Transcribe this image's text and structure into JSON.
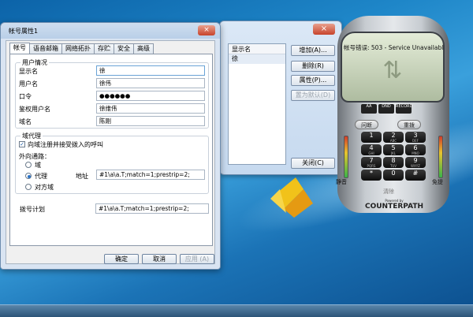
{
  "dialog": {
    "title": "帐号属性1",
    "close_label": "×",
    "tabs": [
      {
        "label": "帐号",
        "active": true
      },
      {
        "label": "语音邮箱",
        "active": false
      },
      {
        "label": "网络拓扑",
        "active": false
      },
      {
        "label": "存贮",
        "active": false
      },
      {
        "label": "安全",
        "active": false
      },
      {
        "label": "高级",
        "active": false
      }
    ],
    "user_info": {
      "group_label": "用户情况",
      "display_name": {
        "label": "显示名",
        "value": "徐"
      },
      "user_name": {
        "label": "用户名",
        "value": "徐伟"
      },
      "password": {
        "label": "口令",
        "value": "●●●●●●"
      },
      "auth_user": {
        "label": "鉴权用户名",
        "value": "徐维伟"
      },
      "domain": {
        "label": "域名",
        "value": "陈刚"
      }
    },
    "proxy": {
      "group_label": "域代理",
      "register_check_label": "向域注册并接受拨入的呼叫",
      "register_checked": true,
      "outbound_label": "外向通路：",
      "options": [
        {
          "label": "域",
          "selected": false
        },
        {
          "label": "代理",
          "selected": true
        },
        {
          "label": "对方域",
          "selected": false
        }
      ],
      "address_label": "地址",
      "address_value": "#1\\a\\a.T;match=1;prestrip=2;"
    },
    "dial_plan": {
      "label": "拨号计划",
      "value": "#1\\a\\a.T;match=1;prestrip=2;"
    },
    "buttons": {
      "ok": "确定",
      "cancel": "取消",
      "apply": "应用 (A)"
    }
  },
  "accounts_window": {
    "close_label": "×",
    "list_header": "显示名",
    "rows": [
      "徐"
    ],
    "buttons": {
      "add": "增加(A)...",
      "remove": "删除(R)",
      "properties": "属性(P)...",
      "set_default": "置为默认(D)",
      "close": "关闭(C)"
    }
  },
  "softphone": {
    "status_text": "帐号错误: 503 - Service Unavailable",
    "mini_buttons": [
      "AA",
      "DND",
      "RECORD"
    ],
    "redial": "问断",
    "hold": "重拨",
    "keys": [
      {
        "digit": "1",
        "sub": ""
      },
      {
        "digit": "2",
        "sub": "ABC"
      },
      {
        "digit": "3",
        "sub": "DEF"
      },
      {
        "digit": "4",
        "sub": "GHI"
      },
      {
        "digit": "5",
        "sub": "JKL"
      },
      {
        "digit": "6",
        "sub": "MNO"
      },
      {
        "digit": "7",
        "sub": "PQRS"
      },
      {
        "digit": "8",
        "sub": "TUV"
      },
      {
        "digit": "9",
        "sub": "WXYZ"
      },
      {
        "digit": "*",
        "sub": ""
      },
      {
        "digit": "0",
        "sub": ""
      },
      {
        "digit": "#",
        "sub": ""
      }
    ],
    "mute": "静音",
    "speaker": "免提",
    "clear": "清除",
    "brand_powered": "Powered by",
    "brand_name": "COUNTERPATH"
  }
}
